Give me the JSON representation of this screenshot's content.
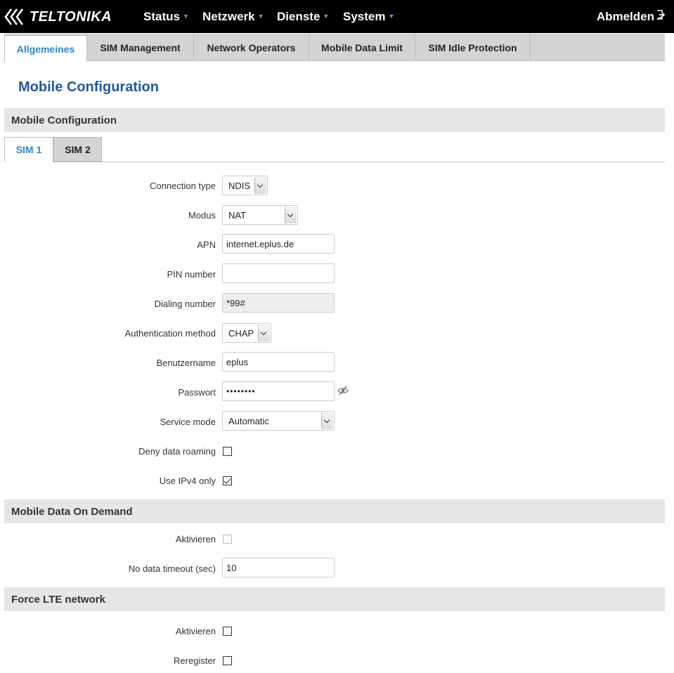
{
  "brand": {
    "name": "TELTONIKA"
  },
  "nav": {
    "items": [
      {
        "label": "Status"
      },
      {
        "label": "Netzwerk"
      },
      {
        "label": "Dienste"
      },
      {
        "label": "System"
      }
    ],
    "logout_label": "Abmelden"
  },
  "tabs": [
    {
      "label": "Allgemeines",
      "active": true
    },
    {
      "label": "SIM Management"
    },
    {
      "label": "Network Operators"
    },
    {
      "label": "Mobile Data Limit"
    },
    {
      "label": "SIM Idle Protection"
    }
  ],
  "page_title": "Mobile Configuration",
  "sections": {
    "mobile_config": "Mobile Configuration",
    "data_on_demand": "Mobile Data On Demand",
    "force_lte": "Force LTE network"
  },
  "sim_tabs": [
    {
      "label": "SIM 1",
      "active": true
    },
    {
      "label": "SIM 2"
    }
  ],
  "form": {
    "connection_type": {
      "label": "Connection type",
      "value": "NDIS"
    },
    "modus": {
      "label": "Modus",
      "value": "NAT"
    },
    "apn": {
      "label": "APN",
      "value": "internet.eplus.de"
    },
    "pin": {
      "label": "PIN number",
      "value": ""
    },
    "dialing": {
      "label": "Dialing number",
      "value": "*99#"
    },
    "auth_method": {
      "label": "Authentication method",
      "value": "CHAP"
    },
    "username": {
      "label": "Benutzername",
      "value": "eplus"
    },
    "password": {
      "label": "Passwort",
      "value": "••••••••"
    },
    "service_mode": {
      "label": "Service mode",
      "value": "Automatic"
    },
    "deny_roaming": {
      "label": "Deny data roaming",
      "checked": false
    },
    "ipv4_only": {
      "label": "Use IPv4 only",
      "checked": true
    }
  },
  "on_demand": {
    "enable": {
      "label": "Aktivieren",
      "checked": false,
      "disabled": true
    },
    "timeout": {
      "label": "No data timeout (sec)",
      "value": "10"
    }
  },
  "force_lte": {
    "enable": {
      "label": "Aktivieren",
      "checked": false
    },
    "reregister": {
      "label": "Reregister",
      "checked": false
    }
  },
  "colors": {
    "accent": "#2d86c4",
    "title": "#24599b",
    "topbar": "#000000",
    "section_bg": "#e6e6e6"
  }
}
